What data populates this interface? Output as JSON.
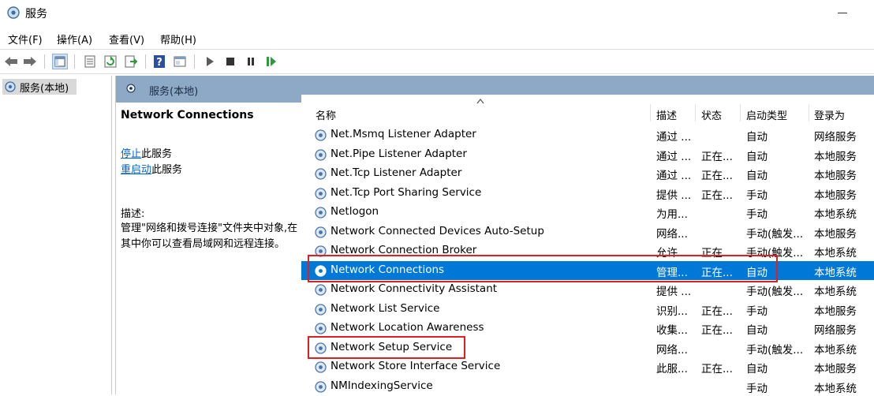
{
  "window": {
    "title": "服务"
  },
  "menu": [
    "文件(F)",
    "操作(A)",
    "查看(V)",
    "帮助(H)"
  ],
  "tree": {
    "root_label": "服务(本地)"
  },
  "pane_header": {
    "title": "服务(本地)"
  },
  "details": {
    "service_name": "Network Connections",
    "stop_link": "停止",
    "stop_suffix": "此服务",
    "restart_link": "重启动",
    "restart_suffix": "此服务",
    "desc_label": "描述:",
    "desc_text": "管理\"网络和拨号连接\"文件夹中对象,在其中你可以查看局域网和远程连接。"
  },
  "columns": {
    "name": "名称",
    "desc": "描述",
    "status": "状态",
    "startup": "启动类型",
    "logon": "登录为"
  },
  "rows": [
    {
      "name": "Net.Msmq Listener Adapter",
      "desc": "通过 ...",
      "status": "",
      "startup": "自动",
      "logon": "网络服务"
    },
    {
      "name": "Net.Pipe Listener Adapter",
      "desc": "通过 ...",
      "status": "正在...",
      "startup": "自动",
      "logon": "本地服务"
    },
    {
      "name": "Net.Tcp Listener Adapter",
      "desc": "通过 ...",
      "status": "正在...",
      "startup": "自动",
      "logon": "本地服务"
    },
    {
      "name": "Net.Tcp Port Sharing Service",
      "desc": "提供 ...",
      "status": "正在...",
      "startup": "手动",
      "logon": "本地服务"
    },
    {
      "name": "Netlogon",
      "desc": "为用...",
      "status": "",
      "startup": "手动",
      "logon": "本地系统"
    },
    {
      "name": "Network Connected Devices Auto-Setup",
      "desc": "网络...",
      "status": "",
      "startup": "手动(触发...",
      "logon": "本地服务"
    },
    {
      "name": "Network Connection Broker",
      "desc": "允许 ...",
      "status": "正在...",
      "startup": "手动(触发...",
      "logon": "本地系统"
    },
    {
      "name": "Network Connections",
      "desc": "管理...",
      "status": "正在...",
      "startup": "自动",
      "logon": "本地系统"
    },
    {
      "name": "Network Connectivity Assistant",
      "desc": "提供 ...",
      "status": "",
      "startup": "手动(触发...",
      "logon": "本地系统"
    },
    {
      "name": "Network List Service",
      "desc": "识别...",
      "status": "正在...",
      "startup": "手动",
      "logon": "本地服务"
    },
    {
      "name": "Network Location Awareness",
      "desc": "收集...",
      "status": "正在...",
      "startup": "自动",
      "logon": "网络服务"
    },
    {
      "name": "Network Setup Service",
      "desc": "网络...",
      "status": "",
      "startup": "手动(触发...",
      "logon": "本地系统"
    },
    {
      "name": "Network Store Interface Service",
      "desc": "此服...",
      "status": "正在...",
      "startup": "自动",
      "logon": "本地服务"
    },
    {
      "name": "NMIndexingService",
      "desc": "",
      "status": "",
      "startup": "手动",
      "logon": "本地系统"
    }
  ],
  "icons": [
    "gear-icon",
    "back-arrow-icon",
    "forward-arrow-icon",
    "console-tree-icon",
    "properties-icon",
    "refresh-icon",
    "export-list-icon",
    "help-icon",
    "view-icon",
    "play-icon",
    "stop-icon",
    "pause-icon",
    "resume-icon",
    "sort-ascending-icon"
  ],
  "colors": {
    "selection": "#0078d7",
    "highlight_box": "#e02020",
    "pane_header": "#8ea9c6",
    "link": "#0066cc"
  }
}
